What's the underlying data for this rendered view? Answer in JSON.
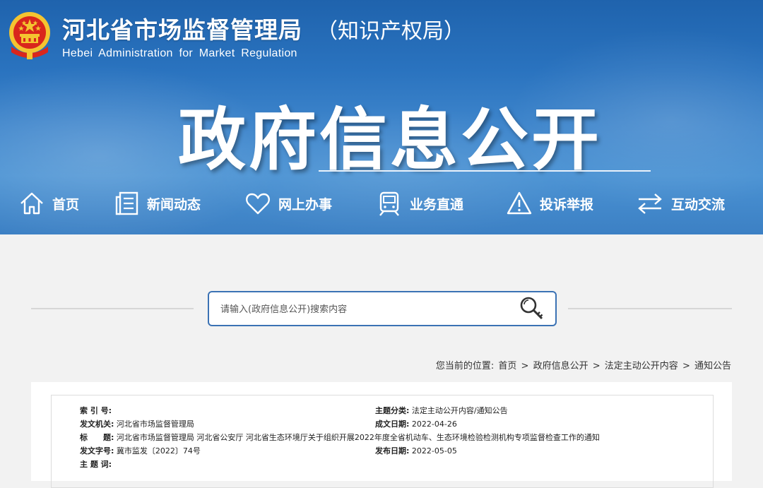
{
  "header": {
    "agency_cn": "河北省市场监督管理局",
    "agency_sub": "（知识产权局）",
    "agency_en": "Hebei Administration for Market Regulation",
    "section_title": "政府信息公开"
  },
  "nav": [
    {
      "label": "首页",
      "icon": "home-icon"
    },
    {
      "label": "新闻动态",
      "icon": "document-list-icon"
    },
    {
      "label": "网上办事",
      "icon": "heart-icon"
    },
    {
      "label": "业务直通",
      "icon": "train-icon"
    },
    {
      "label": "投诉举报",
      "icon": "warning-icon"
    },
    {
      "label": "互动交流",
      "icon": "exchange-arrows-icon"
    }
  ],
  "search": {
    "placeholder": "请输入(政府信息公开)搜索内容",
    "value": ""
  },
  "breadcrumb": {
    "prefix": "您当前的位置:",
    "items": [
      "首页",
      "政府信息公开",
      "法定主动公开内容",
      "通知公告"
    ],
    "separator": ">"
  },
  "document": {
    "index_label": "索 引 号:",
    "index_value": "",
    "topic_label": "主题分类:",
    "topic_value": "法定主动公开内容/通知公告",
    "issuer_label": "发文机关:",
    "issuer_value": "河北省市场监督管理局",
    "date_label": "成文日期:",
    "date_value": "2022-04-26",
    "title_label": "标　　题:",
    "title_value": "河北省市场监督管理局 河北省公安厅 河北省生态环境厅关于组织开展2022年度全省机动车、生态环境检验检测机构专项监督检查工作的通知",
    "docno_label": "发文字号:",
    "docno_value": "冀市监发〔2022〕74号",
    "pubdate_label": "发布日期:",
    "pubdate_value": "2022-05-05",
    "keywords_label": "主 题 词:",
    "keywords_value": ""
  },
  "colors": {
    "banner_top": "#1f63ad",
    "banner_bottom": "#4a92d3",
    "search_border": "#3b72b4",
    "emblem_red": "#d9261c",
    "emblem_gold": "#f4c430"
  }
}
